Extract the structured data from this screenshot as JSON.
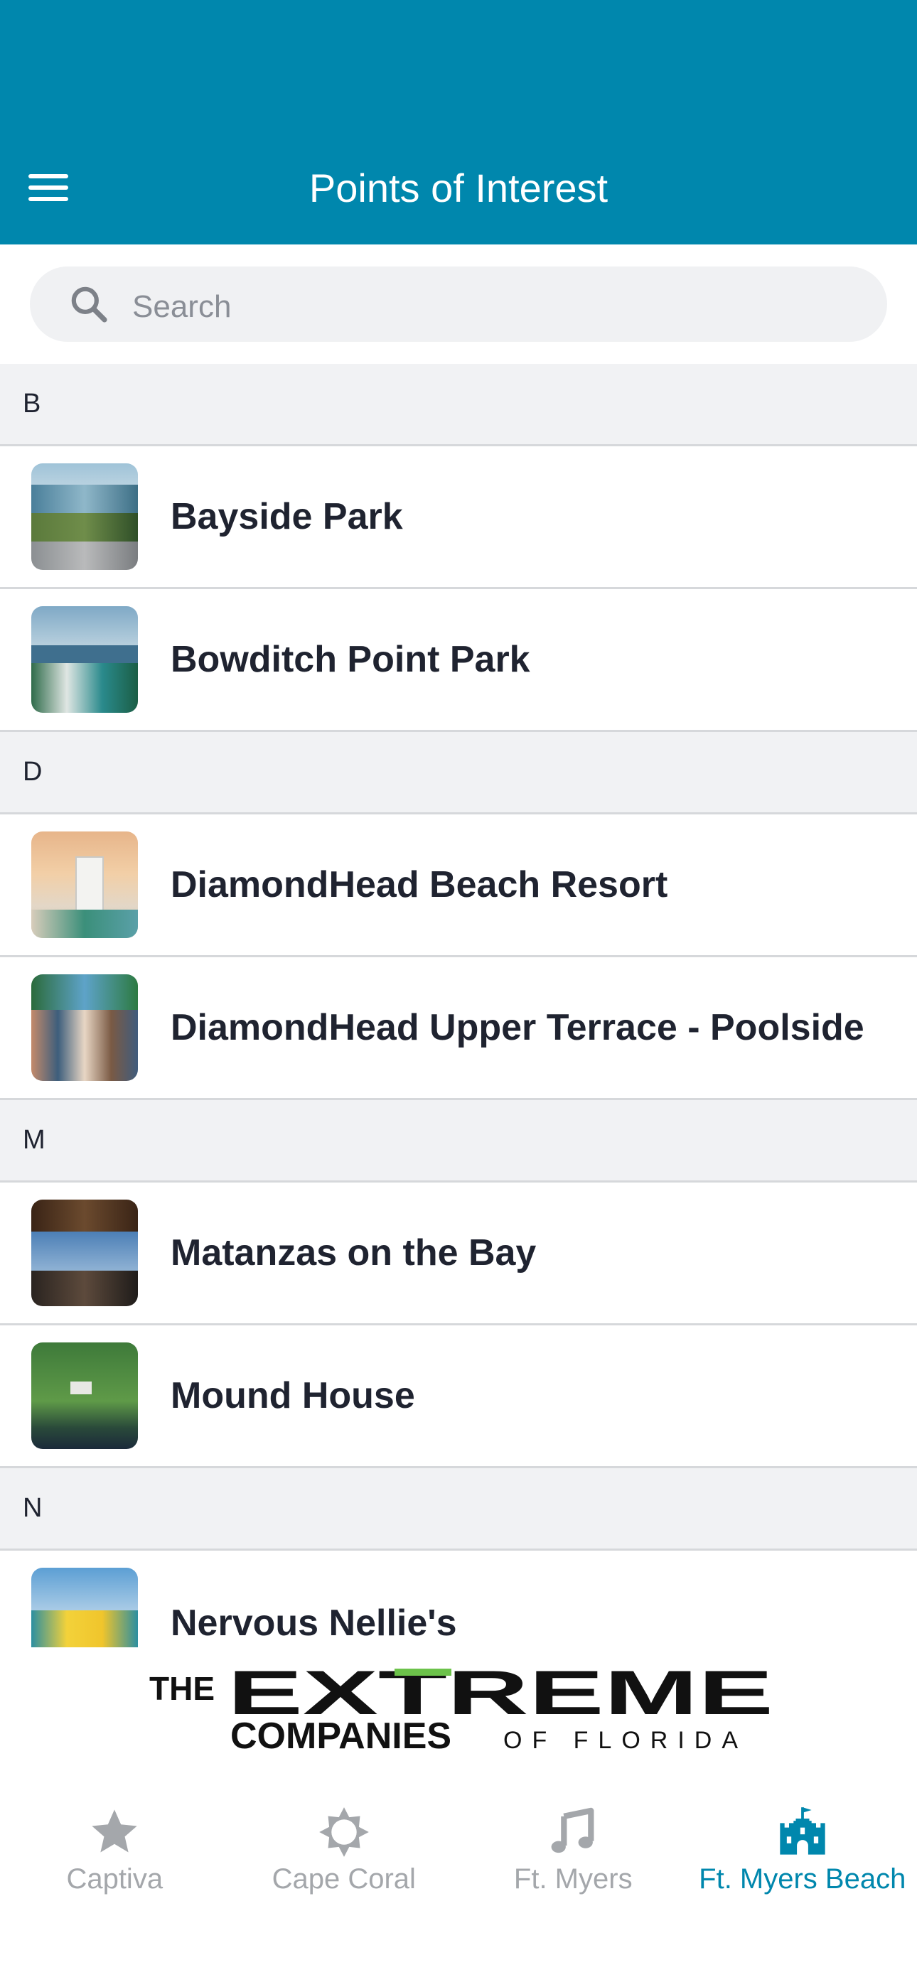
{
  "header": {
    "title": "Points of Interest"
  },
  "search": {
    "placeholder": "Search"
  },
  "sections": [
    {
      "letter": "B",
      "items": [
        "Bayside Park",
        "Bowditch Point Park"
      ]
    },
    {
      "letter": "D",
      "items": [
        "DiamondHead Beach Resort",
        "DiamondHead Upper Terrace - Poolside"
      ]
    },
    {
      "letter": "M",
      "items": [
        "Matanzas on the Bay",
        "Mound House"
      ]
    },
    {
      "letter": "N",
      "items": [
        "Nervous Nellie's"
      ]
    }
  ],
  "banner": {
    "line1_prefix": "THE",
    "line1_main": "EXTREME",
    "line2_main": "COMPANIES",
    "line2_suffix": "OF FLORIDA"
  },
  "tabs": [
    {
      "label": "Captiva",
      "icon": "star-icon",
      "active": false
    },
    {
      "label": "Cape Coral",
      "icon": "sun-icon",
      "active": false
    },
    {
      "label": "Ft. Myers",
      "icon": "music-note-icon",
      "active": false
    },
    {
      "label": "Ft. Myers Beach",
      "icon": "castle-icon",
      "active": true
    }
  ],
  "colors": {
    "brand": "#0087ad",
    "inactive_tab": "#a4a7ab",
    "text": "#1f2330",
    "logo_green": "#6cc24a"
  }
}
